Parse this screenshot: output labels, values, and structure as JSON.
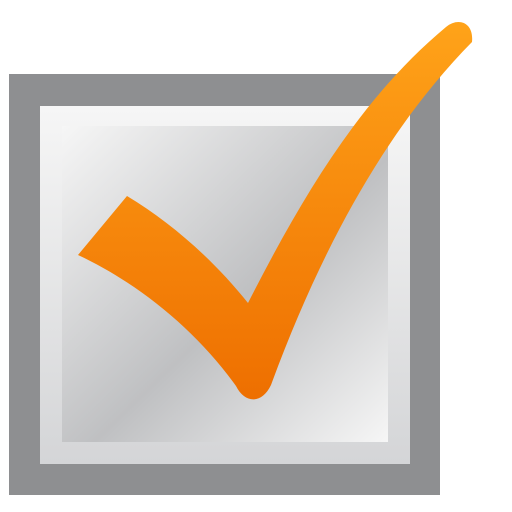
{
  "icon": {
    "name": "checked-checkbox-icon",
    "state": "checked",
    "colors": {
      "frame_outer": "#8e8f91",
      "frame_inner": "#d4d5d7",
      "panel_light": "#f6f6f6",
      "panel_shade": "#bfc0c2",
      "check_top": "#ffa319",
      "check_bottom": "#ee6f00"
    }
  }
}
